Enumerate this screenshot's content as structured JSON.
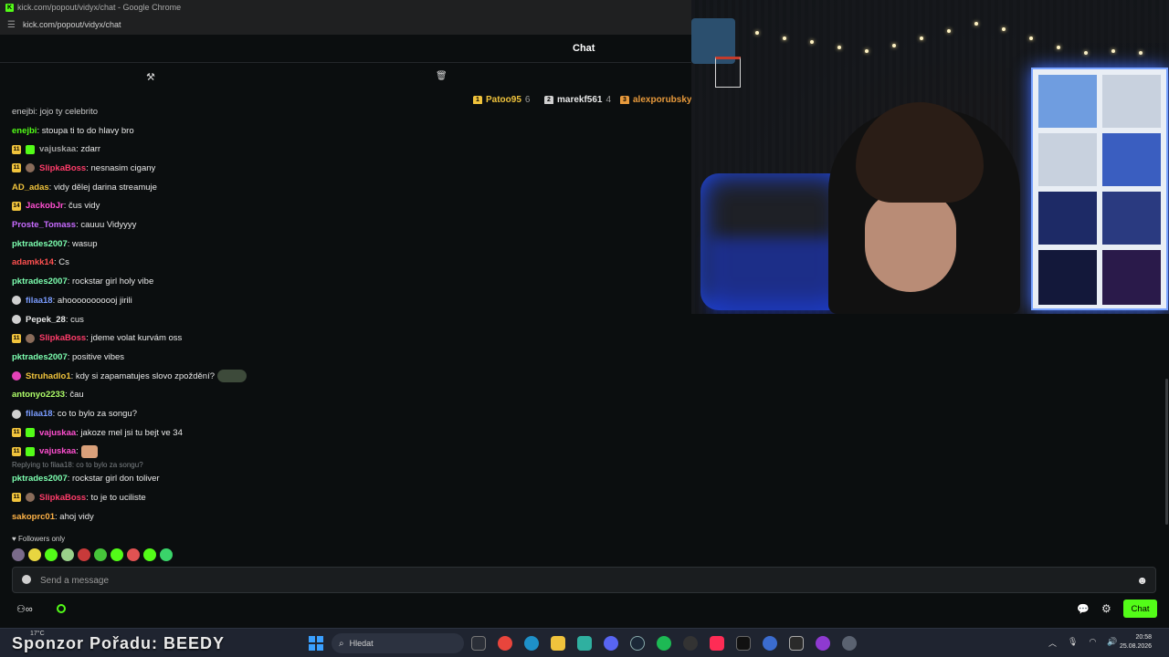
{
  "browser": {
    "window_title": "kick.com/popout/vidyx/chat - Google Chrome",
    "url": "kick.com/popout/vidyx/chat"
  },
  "chat": {
    "title": "Chat",
    "pinned_partial": "enejbi: jojo ty celebrito",
    "leaderboard": [
      {
        "name": "Patoo95",
        "count": "6",
        "color": "#f0c33c"
      },
      {
        "name": "marekf561",
        "count": "4",
        "color": "#d0d0d0"
      },
      {
        "name": "alexporubsky",
        "count": "",
        "color": "#e89a3c"
      }
    ],
    "messages": [
      {
        "badges": [],
        "user": "enejbi",
        "color": "#53fc18",
        "text": ": stoupa ti to do hlavy bro"
      },
      {
        "badges": [
          "11",
          "gift"
        ],
        "user": "vajuskaa",
        "color": "#a0a0a0",
        "text": ": zdarr"
      },
      {
        "badges": [
          "11",
          "avatar"
        ],
        "user": "SlipkaBoss",
        "color": "#ff3c6a",
        "text": ": nesnasim cigany"
      },
      {
        "badges": [],
        "user": "AD_adas",
        "color": "#f0c33c",
        "text": ": vidy dělej darina streamuje"
      },
      {
        "badges": [
          "14"
        ],
        "user": "JackobJr",
        "color": "#ff4fd0",
        "text": ": čus vidy"
      },
      {
        "badges": [],
        "user": "Proste_Tomass",
        "color": "#c86bff",
        "text": ": cauuu Vidyyyy"
      },
      {
        "badges": [],
        "user": "pktrades2007",
        "color": "#7dffb0",
        "text": ": wasup"
      },
      {
        "badges": [],
        "user": "adamkk14",
        "color": "#ff5050",
        "text": ": Cs"
      },
      {
        "badges": [],
        "user": "pktrades2007",
        "color": "#7dffb0",
        "text": ": rockstar girl holy vibe"
      },
      {
        "badges": [
          "vip"
        ],
        "user": "filaa18",
        "color": "#7a9cff",
        "text": ": ahooooooooooj jirili"
      },
      {
        "badges": [
          "vip"
        ],
        "user": "Pepek_28",
        "color": "#e8e8e8",
        "text": ": cus"
      },
      {
        "badges": [
          "11",
          "avatar"
        ],
        "user": "SlipkaBoss",
        "color": "#ff3c6a",
        "text": ": jdeme volat kurvám oss"
      },
      {
        "badges": [],
        "user": "pktrades2007",
        "color": "#7dffb0",
        "text": ": positive vibes"
      },
      {
        "badges": [
          "og"
        ],
        "user": "Struhadlo1",
        "color": "#f0c33c",
        "text": ": kdy si zapamatujes slovo zpoždění?",
        "emote": "emote"
      },
      {
        "badges": [],
        "user": "antonyo2233",
        "color": "#b0ff6a",
        "text": ": čau"
      },
      {
        "badges": [
          "vip"
        ],
        "user": "filaa18",
        "color": "#7a9cff",
        "text": ": co to bylo za songu?"
      },
      {
        "badges": [
          "11",
          "gift"
        ],
        "user": "vajuskaa",
        "color": "#ff4fd0",
        "text": ": jakoze mel jsi tu bejt ve 34"
      },
      {
        "badges": [
          "11",
          "gift"
        ],
        "user": "vajuskaa",
        "color": "#ff4fd0",
        "text": ":",
        "emote": "hand"
      },
      {
        "badges": [],
        "user": "pktrades2007",
        "color": "#7dffb0",
        "text": ": rockstar girl don toliver",
        "reply": "Replying to filaa18: co to bylo za songu?"
      },
      {
        "badges": [
          "11",
          "avatar"
        ],
        "user": "SlipkaBoss",
        "color": "#ff3c6a",
        "text": ": to je to uciliste"
      },
      {
        "badges": [],
        "user": "sakoprc01",
        "color": "#ffb347",
        "text": ": ahoj vidy"
      }
    ],
    "followers_only": "Followers only",
    "input_placeholder": "Send a message",
    "chat_button": "Chat"
  },
  "taskbar": {
    "sponsor": "Sponzor Pořadu: BEEDY",
    "weather": "17°C",
    "search_placeholder": "Hledat",
    "time": "20:58",
    "date": "25.08.2026"
  }
}
